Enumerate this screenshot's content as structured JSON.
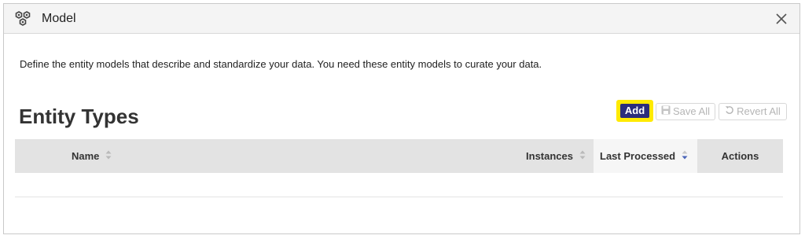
{
  "window": {
    "title": "Model",
    "icon": "model-hexagons-icon",
    "close_icon": "close-icon"
  },
  "description": "Define the entity models that describe and standardize your data. You need these entity models to curate your data.",
  "section": {
    "heading": "Entity Types"
  },
  "toolbar": {
    "add_label": "Add",
    "save_all_label": "Save All",
    "revert_all_label": "Revert All",
    "add_bg_color": "#2b2d7c",
    "highlight_color": "#ffea00"
  },
  "table": {
    "columns": [
      {
        "label": "Name",
        "sort": "none"
      },
      {
        "label": "Instances",
        "sort": "none"
      },
      {
        "label": "Last Processed",
        "sort": "desc"
      },
      {
        "label": "Actions"
      }
    ],
    "rows": []
  }
}
